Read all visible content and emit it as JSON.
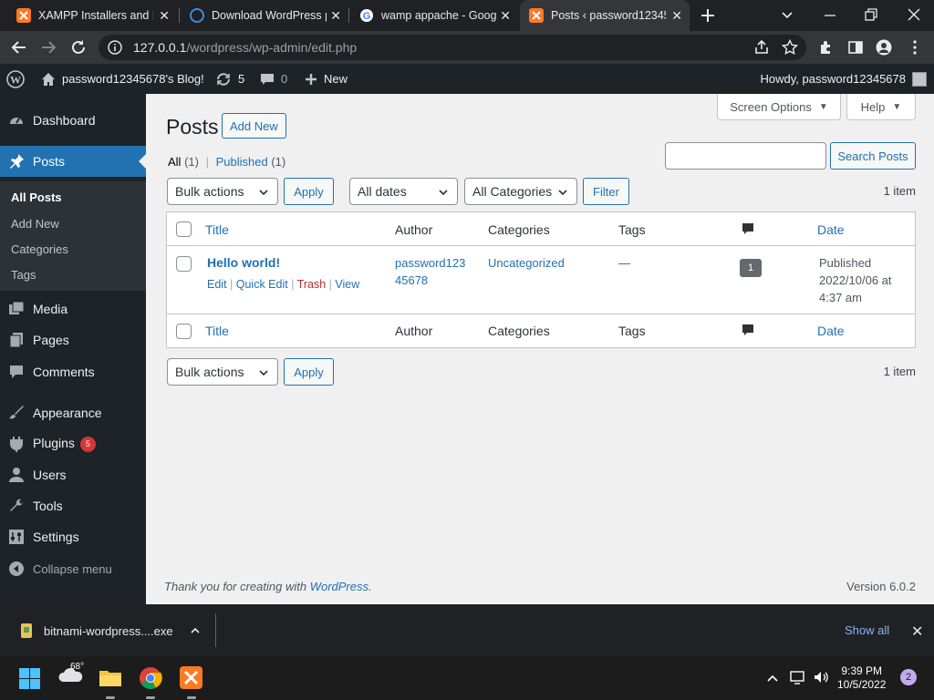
{
  "browser": {
    "tabs": [
      {
        "title": "XAMPP Installers and D",
        "icon": "xampp-icon"
      },
      {
        "title": "Download WordPress p",
        "icon": "wordpress-icon"
      },
      {
        "title": "wamp appache - Goog",
        "icon": "google-icon"
      },
      {
        "title": "Posts ‹ password12345",
        "icon": "xampp-icon",
        "active": true
      }
    ],
    "address_host": "127.0.0.1",
    "address_path": "/wordpress/wp-admin/edit.php"
  },
  "adminbar": {
    "site_name": "password12345678's Blog!",
    "updates_count": "5",
    "comments_count": "0",
    "new_label": "New",
    "howdy": "Howdy, password12345678"
  },
  "sidebar": {
    "dashboard": "Dashboard",
    "posts": "Posts",
    "sub": {
      "all_posts": "All Posts",
      "add_new": "Add New",
      "categories": "Categories",
      "tags": "Tags"
    },
    "media": "Media",
    "pages": "Pages",
    "comments": "Comments",
    "appearance": "Appearance",
    "plugins": "Plugins",
    "plugins_badge": "5",
    "users": "Users",
    "tools": "Tools",
    "settings": "Settings",
    "collapse": "Collapse menu"
  },
  "content": {
    "screen_options": "Screen Options",
    "help": "Help",
    "title": "Posts",
    "add_new": "Add New",
    "filter_all": "All",
    "filter_all_count": "(1)",
    "filter_sep": "|",
    "filter_published": "Published",
    "filter_published_count": "(1)",
    "search_value": "",
    "search_button": "Search Posts",
    "bulk_actions": "Bulk actions",
    "apply": "Apply",
    "all_dates": "All dates",
    "all_categories": "All Categories",
    "filter": "Filter",
    "item_count": "1 item",
    "columns": {
      "title": "Title",
      "author": "Author",
      "categories": "Categories",
      "tags": "Tags",
      "date": "Date"
    },
    "post": {
      "title": "Hello world!",
      "actions": {
        "edit": "Edit",
        "quick_edit": "Quick Edit",
        "trash": "Trash",
        "view": "View"
      },
      "author_line1": "password123",
      "author_line2": "45678",
      "category": "Uncategorized",
      "tags": "—",
      "comments": "1",
      "date_status": "Published",
      "date_line1": "2022/10/06 at",
      "date_line2": "4:37 am"
    },
    "footer_prefix": "Thank you for creating with ",
    "footer_link": "WordPress",
    "footer_suffix": ".",
    "version": "Version 6.0.2"
  },
  "downloads": {
    "file": "bitnami-wordpress....exe",
    "show_all": "Show all"
  },
  "taskbar": {
    "weather": "68°",
    "time": "9:39 PM",
    "date": "10/5/2022",
    "notifications": "2"
  }
}
